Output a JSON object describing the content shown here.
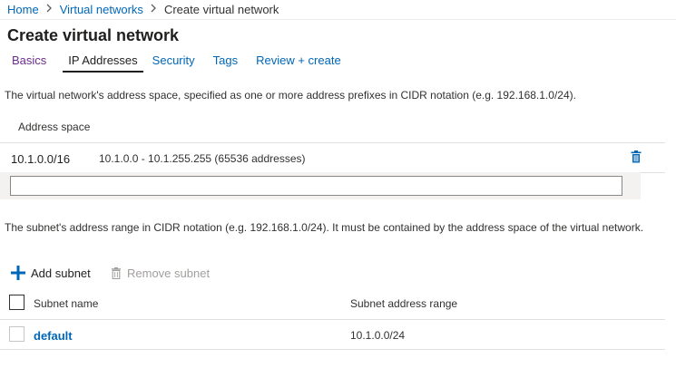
{
  "breadcrumb": {
    "items": [
      "Home",
      "Virtual networks"
    ],
    "current": "Create virtual network",
    "separator": ">"
  },
  "page": {
    "title": "Create virtual network"
  },
  "tabs": [
    {
      "label": "Basics",
      "state": "visited"
    },
    {
      "label": "IP Addresses",
      "state": "active"
    },
    {
      "label": "Security",
      "state": "link"
    },
    {
      "label": "Tags",
      "state": "link"
    },
    {
      "label": "Review + create",
      "state": "link"
    }
  ],
  "address_section": {
    "description": "The virtual network's address space, specified as one or more address prefixes in CIDR notation (e.g. 192.168.1.0/24).",
    "header": "Address space",
    "rows": [
      {
        "prefix": "10.1.0.0/16",
        "range": "10.1.0.0 - 10.1.255.255 (65536 addresses)"
      }
    ],
    "new_input_value": ""
  },
  "subnet_section": {
    "description": "The subnet's address range in CIDR notation (e.g. 192.168.1.0/24). It must be contained by the address space of the virtual network.",
    "add_label": "Add subnet",
    "remove_label": "Remove subnet",
    "columns": [
      "Subnet name",
      "Subnet address range"
    ],
    "rows": [
      {
        "name": "default",
        "range": "10.1.0.0/24"
      }
    ]
  },
  "colors": {
    "link": "#0067b8",
    "visited": "#6b2d8b",
    "text": "#323130",
    "disabled": "#a19f9d"
  }
}
